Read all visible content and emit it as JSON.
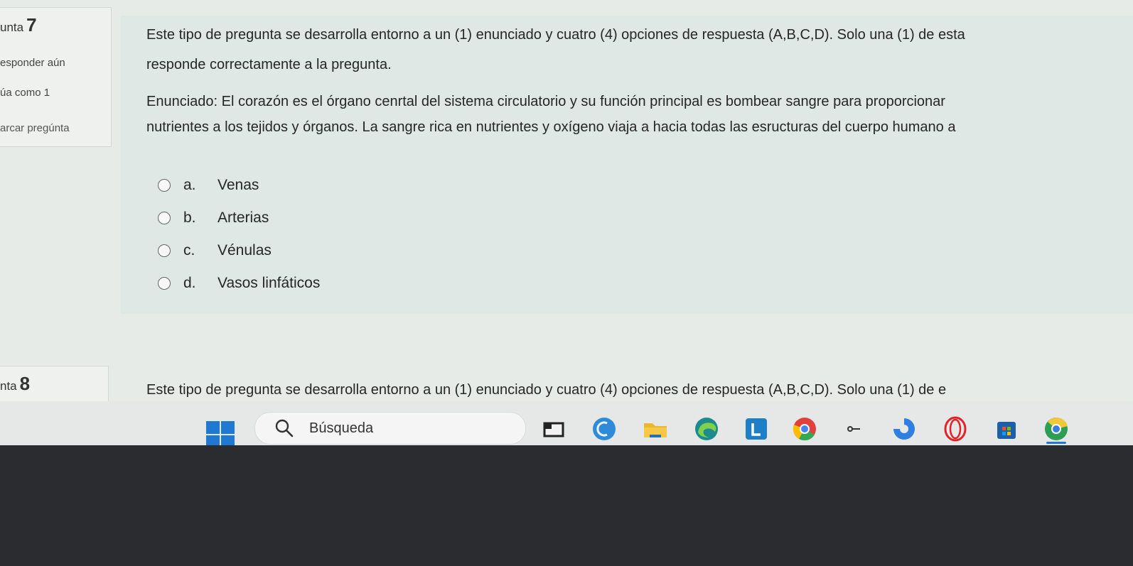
{
  "question7": {
    "number_prefix": "unta",
    "number": "7",
    "status": "esponder aún",
    "grade": "úa como 1",
    "flag": "arcar pregúnta",
    "intro_line1": "Este tipo de pregunta se desarrolla entorno a un (1) enunciado y cuatro (4) opciones de respuesta (A,B,C,D). Solo una (1) de esta",
    "intro_line2": "responde correctamente a la pregunta.",
    "statement_line1": "Enunciado: El corazón es el órgano cenrtal del sistema circulatorio y su función principal es bombear sangre para proporcionar",
    "statement_line2": "nutrientes a los tejidos y órganos. La sangre rica en nutrientes y oxígeno viaja a hacia todas las esructuras del cuerpo humano a",
    "options": [
      {
        "letter": "a.",
        "text": "Venas"
      },
      {
        "letter": "b.",
        "text": "Arterias"
      },
      {
        "letter": "c.",
        "text": "Vénulas"
      },
      {
        "letter": "d.",
        "text": "Vasos linfáticos"
      }
    ]
  },
  "question8": {
    "number_prefix": "nta",
    "number": "8",
    "intro_line1": "Este tipo de pregunta se desarrolla entorno a un (1) enunciado y cuatro (4) opciones de respuesta (A,B,C,D). Solo una (1) de e"
  },
  "taskbar": {
    "search_label": "Búsqueda",
    "icons": [
      "windows-start-icon",
      "search-icon",
      "task-view-icon",
      "copilot-icon",
      "file-explorer-icon",
      "edge-icon",
      "lens-icon",
      "chrome-icon",
      "key-icon",
      "app-icon",
      "opera-icon",
      "store-icon",
      "chrome-profile-icon"
    ]
  },
  "colors": {
    "page_bg": "#e7ebe8",
    "question_bg": "#dfe8e4",
    "accent_blue": "#1f78d1"
  }
}
